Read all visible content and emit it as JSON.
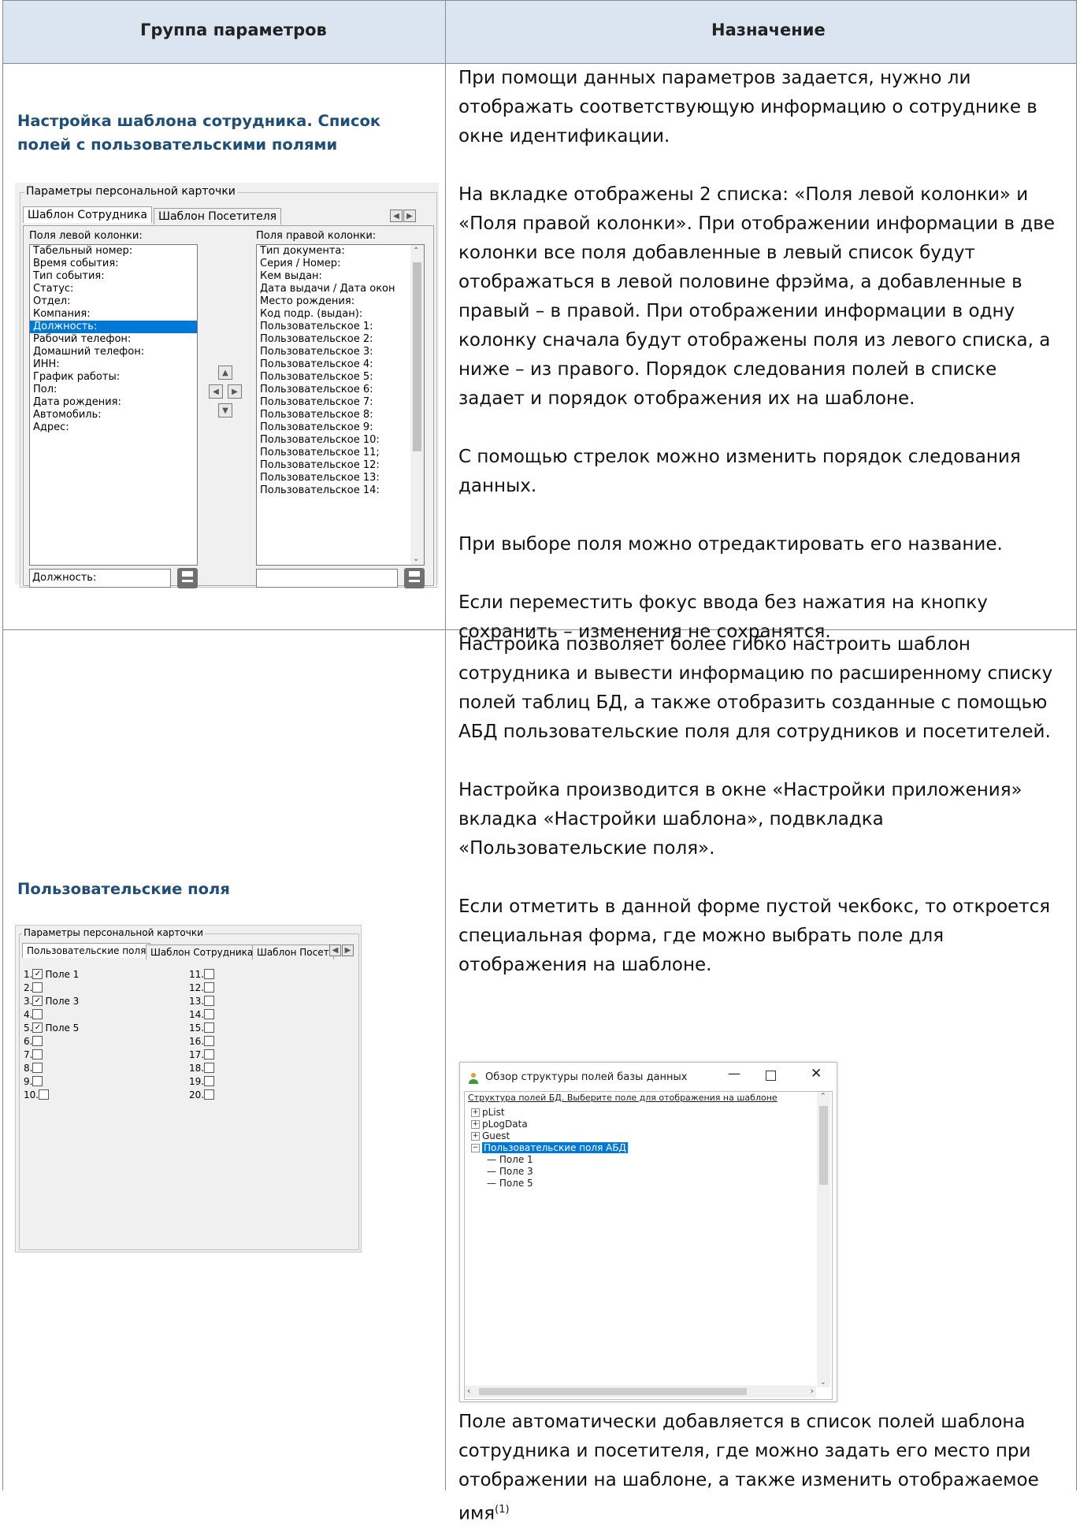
{
  "header": {
    "col1": "Группа параметров",
    "col2": "Назначение"
  },
  "row1": {
    "title_line1": "Настройка шаблона сотрудника. Список",
    "title_line2": "полей с пользовательскими полями",
    "paragraphs": [
      "При помощи данных параметров задается, нужно ли отображать соответствующую информацию о сотруднике в окне идентификации.",
      "На вкладке отображены 2 списка: «Поля левой колонки» и «Поля правой колонки». При отображении информации в две колонки все поля добавленные в левый список будут отображаться в левой половине фрэйма, а добавленные в правый – в правой. При отображении информации в одну колонку сначала будут отображены поля из левого списка, а ниже – из правого. Порядок следования полей в списке задает и порядок отображения их на шаблоне.",
      "С помощью стрелок можно изменить порядок следования данных.",
      "При выборе поля можно отредактировать его название.",
      "Если переместить фокус ввода без нажатия на кнопку сохранить – изменения не сохранятся."
    ],
    "window": {
      "group_label": "Параметры персональной карточки",
      "tab_active": "Шаблон Сотрудника",
      "tab_other": "Шаблон Посетителя",
      "left_label": "Поля левой колонки:",
      "right_label": "Поля правой колонки:",
      "left_items": [
        "Табельный номер:",
        "Время события:",
        "Тип события:",
        "Статус:",
        "Отдел:",
        "Компания:",
        "Должность:",
        "Рабочий телефон:",
        "Домашний телефон:",
        "ИНН:",
        "График работы:",
        "Пол:",
        "Дата рождения:",
        "Автомобиль:",
        "Адрес:"
      ],
      "selected_index": 6,
      "right_items": [
        "Тип документа:",
        "Серия / Номер:",
        "Кем выдан:",
        "Дата выдачи / Дата окон",
        "Место рождения:",
        "Код подр. (выдан):",
        "Пользовательское 1:",
        "Пользовательское 2:",
        "Пользовательское 3:",
        "Пользовательское 4:",
        "Пользовательское 5:",
        "Пользовательское 6:",
        "Пользовательское 7:",
        "Пользовательское 8:",
        "Пользовательское 9:",
        "Пользовательское 10:",
        "Пользовательское 11;",
        "Пользовательское 12:",
        "Пользовательское 13:",
        "Пользовательское 14:"
      ],
      "left_input_value": "Должность:",
      "right_input_value": ""
    }
  },
  "row2": {
    "title": "Пользовательские поля",
    "paragraphs": [
      "Настройка позволяет более гибко настроить шаблон сотрудника и вывести информацию по расширенному списку полей таблиц БД, а также отобразить созданные с помощью АБД пользовательские поля для сотрудников и посетителей.",
      "Настройка производится в окне «Настройки приложения» вкладка «Настройки шаблона», подвкладка «Пользовательские поля».",
      "Если отметить в данной форме пустой чекбокс, то откроется специальная форма, где можно выбрать поле для отображения на шаблоне."
    ],
    "last_paragraph": "Поле автоматически добавляется в список полей шаблона сотрудника и посетителя, где можно задать его место при отображении на шаблоне, а также изменить отображаемое имя",
    "footnote": "(1)",
    "window": {
      "group_label": "Параметры персональной карточки",
      "tabs": [
        "Пользовательские поля",
        "Шаблон Сотрудника",
        "Шаблон Посет"
      ],
      "checkboxes_left": [
        {
          "num": "1.",
          "checked": true,
          "label": "Поле 1"
        },
        {
          "num": "2.",
          "checked": false,
          "label": ""
        },
        {
          "num": "3.",
          "checked": true,
          "label": "Поле 3"
        },
        {
          "num": "4.",
          "checked": false,
          "label": ""
        },
        {
          "num": "5.",
          "checked": true,
          "label": "Поле 5"
        },
        {
          "num": "6.",
          "checked": false,
          "label": ""
        },
        {
          "num": "7.",
          "checked": false,
          "label": ""
        },
        {
          "num": "8.",
          "checked": false,
          "label": ""
        },
        {
          "num": "9.",
          "checked": false,
          "label": ""
        },
        {
          "num": "10.",
          "checked": false,
          "label": ""
        }
      ],
      "checkboxes_right": [
        "11.",
        "12.",
        "13.",
        "14.",
        "15.",
        "16.",
        "17.",
        "18.",
        "19.",
        "20."
      ]
    },
    "dialog": {
      "title": "Обзор структуры полей базы данных",
      "header_text": "Структура полей БД. Выберите поле для отображения на шаблоне",
      "nodes": [
        "pList",
        "pLogData",
        "Guest"
      ],
      "expanded_node": "Пользовательские поля АБД",
      "children": [
        "Поле 1",
        "Поле 3",
        "Поле 5"
      ]
    }
  }
}
